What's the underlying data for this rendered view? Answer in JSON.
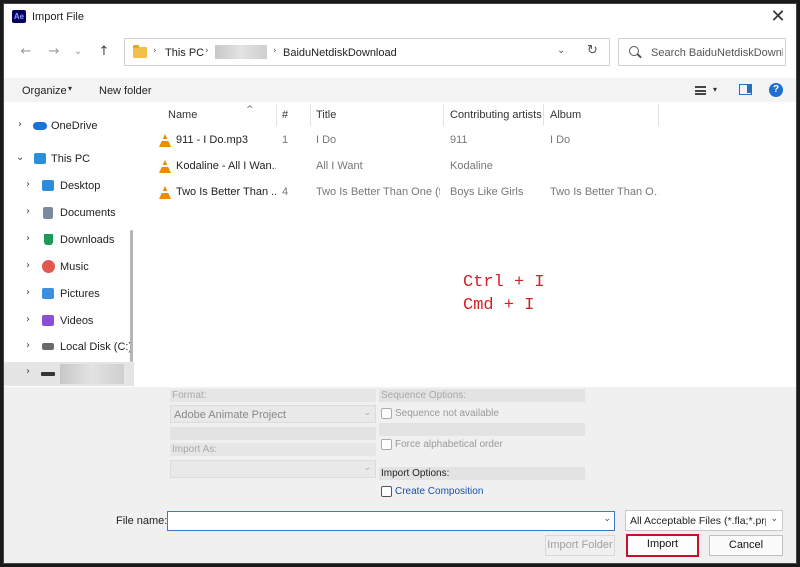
{
  "window": {
    "app_icon_text": "Ae",
    "title": "Import File",
    "close_glyph": "✕"
  },
  "nav": {
    "back_glyph": "←",
    "forward_glyph": "→",
    "recent_glyph": "⌄",
    "up_glyph": "↑"
  },
  "address": {
    "crumbs": [
      "This PC",
      "BaiduNetdiskDownload"
    ],
    "separator": "›",
    "dropdown_glyph": "⌄",
    "refresh_glyph": "↻"
  },
  "search": {
    "placeholder": "Search BaiduNetdiskDownlo..."
  },
  "toolbar": {
    "organize_label": "Organize",
    "organize_caret": "▾",
    "new_folder_label": "New folder",
    "view_caret": "▾",
    "help_glyph": "?"
  },
  "sidebar": {
    "items": [
      {
        "label": "OneDrive",
        "chevron": "›",
        "icon": "onedrive-icon",
        "color": "#1a73d8"
      },
      {
        "label": "This PC",
        "chevron": "⌄",
        "icon": "computer-icon",
        "color": "#2b8fd9"
      },
      {
        "label": "Desktop",
        "chevron": "›",
        "icon": "desktop-icon",
        "color": "#2e8bd8"
      },
      {
        "label": "Documents",
        "chevron": "›",
        "icon": "documents-icon",
        "color": "#7a8aa0"
      },
      {
        "label": "Downloads",
        "chevron": "›",
        "icon": "downloads-icon",
        "color": "#1d9a5a"
      },
      {
        "label": "Music",
        "chevron": "›",
        "icon": "music-icon",
        "color": "#e0584e"
      },
      {
        "label": "Pictures",
        "chevron": "›",
        "icon": "pictures-icon",
        "color": "#3d8fe0"
      },
      {
        "label": "Videos",
        "chevron": "›",
        "icon": "videos-icon",
        "color": "#8a4fd6"
      },
      {
        "label": "Local Disk (C:)",
        "chevron": "›",
        "icon": "drive-icon",
        "color": "#6a6a6a"
      },
      {
        "label": "",
        "chevron": "›",
        "icon": "drive-icon",
        "color": "#333333"
      }
    ]
  },
  "files": {
    "columns": [
      "Name",
      "#",
      "Title",
      "Contributing artists",
      "Album"
    ],
    "sort_glyph": "^",
    "rows": [
      {
        "name": "911 - I Do.mp3",
        "track": "1",
        "title": "I Do",
        "artist": "911",
        "album": "I Do"
      },
      {
        "name": "Kodaline - All I Wan...",
        "track": "",
        "title": "All I Want",
        "artist": "Kodaline",
        "album": ""
      },
      {
        "name": "Two Is Better Than ...",
        "track": "4",
        "title": "Two Is Better Than One (fe...",
        "artist": "Boys Like Girls",
        "album": "Two Is Better Than O..."
      }
    ]
  },
  "annotation": {
    "line1": "Ctrl + I",
    "line2": "Cmd + I",
    "color": "#d32020"
  },
  "options": {
    "format_label": "Format:",
    "format_value": "Adobe Animate Project",
    "import_as_label": "Import As:",
    "import_as_value": "",
    "sequence_options_label": "Sequence Options:",
    "sequence_not_available": "Sequence not available",
    "force_alphabetical": "Force alphabetical order",
    "import_options_label": "Import Options:",
    "create_composition": "Create Composition",
    "caret": "⌄"
  },
  "footer": {
    "file_name_label": "File name:",
    "file_name_value": "",
    "file_name_caret": "⌄",
    "filter_value": "All Acceptable Files (*.fla;*.prpr",
    "filter_caret": "⌄",
    "import_folder_label": "Import Folder",
    "import_label": "Import",
    "cancel_label": "Cancel",
    "accent_color": "#c8102e"
  }
}
